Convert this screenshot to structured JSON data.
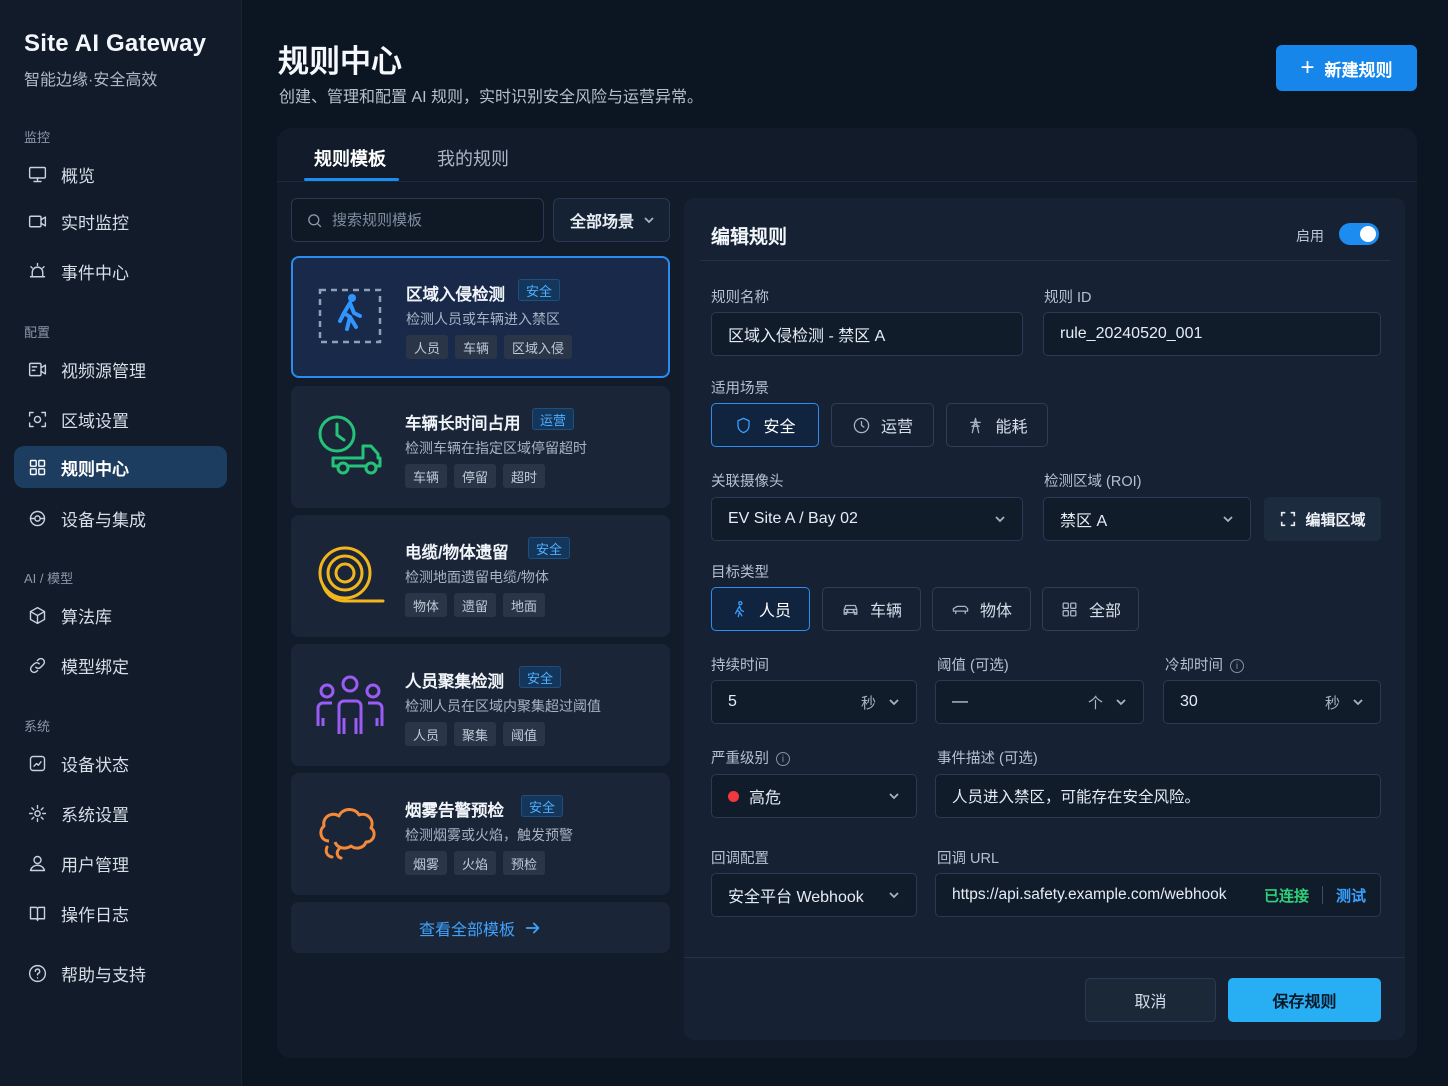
{
  "brand": {
    "title": "Site AI Gateway",
    "subtitle": "智能边缘·安全高效"
  },
  "sidebar": {
    "sections": [
      "监控",
      "配置",
      "AI / 模型",
      "系统"
    ],
    "items": [
      {
        "label": "概览",
        "icon": "monitor-icon"
      },
      {
        "label": "实时监控",
        "icon": "camera-icon"
      },
      {
        "label": "事件中心",
        "icon": "alarm-icon"
      },
      {
        "label": "视频源管理",
        "icon": "video-source-icon"
      },
      {
        "label": "区域设置",
        "icon": "region-icon"
      },
      {
        "label": "规则中心",
        "icon": "grid-icon",
        "active": true
      },
      {
        "label": "设备与集成",
        "icon": "integration-icon"
      },
      {
        "label": "算法库",
        "icon": "cube-icon"
      },
      {
        "label": "模型绑定",
        "icon": "link-icon"
      },
      {
        "label": "设备状态",
        "icon": "device-status-icon"
      },
      {
        "label": "系统设置",
        "icon": "gear-icon"
      },
      {
        "label": "用户管理",
        "icon": "user-icon"
      },
      {
        "label": "操作日志",
        "icon": "book-icon"
      },
      {
        "label": "帮助与支持",
        "icon": "help-icon"
      }
    ]
  },
  "header": {
    "title": "规则中心",
    "subtitle": "创建、管理和配置 AI 规则，实时识别安全风险与运营异常。",
    "new_button": "新建规则"
  },
  "tabs": [
    "规则模板",
    "我的规则"
  ],
  "templates": {
    "search_placeholder": "搜索规则模板",
    "scene_filter": "全部场景",
    "items": [
      {
        "name": "区域入侵检测",
        "tag": "安全",
        "desc": "检测人员或车辆进入禁区",
        "chips": [
          "人员",
          "车辆",
          "区域入侵"
        ]
      },
      {
        "name": "车辆长时间占用",
        "tag": "运营",
        "desc": "检测车辆在指定区域停留超时",
        "chips": [
          "车辆",
          "停留",
          "超时"
        ]
      },
      {
        "name": "电缆/物体遗留",
        "tag": "安全",
        "desc": "检测地面遗留电缆/物体",
        "chips": [
          "物体",
          "遗留",
          "地面"
        ]
      },
      {
        "name": "人员聚集检测",
        "tag": "安全",
        "desc": "检测人员在区域内聚集超过阈值",
        "chips": [
          "人员",
          "聚集",
          "阈值"
        ]
      },
      {
        "name": "烟雾告警预检",
        "tag": "安全",
        "desc": "检测烟雾或火焰，触发预警",
        "chips": [
          "烟雾",
          "火焰",
          "预检"
        ]
      }
    ],
    "view_all": "查看全部模板"
  },
  "editor": {
    "title": "编辑规则",
    "enable_label": "启用",
    "enabled": true,
    "rule_name_label": "规则名称",
    "rule_name": "区域入侵检测 - 禁区 A",
    "rule_id_label": "规则 ID",
    "rule_id": "rule_20240520_001",
    "scene_label": "适用场景",
    "scenes": [
      "安全",
      "运营",
      "能耗"
    ],
    "camera_label": "关联摄像头",
    "camera": "EV Site A / Bay 02",
    "roi_label": "检测区域 (ROI)",
    "roi": "禁区 A",
    "edit_roi_button": "编辑区域",
    "target_label": "目标类型",
    "targets": [
      "人员",
      "车辆",
      "物体",
      "全部"
    ],
    "duration_label": "持续时间",
    "duration": "5",
    "duration_unit": "秒",
    "threshold_label": "阈值 (可选)",
    "threshold": "—",
    "threshold_unit": "个",
    "cooldown_label": "冷却时间",
    "cooldown": "30",
    "cooldown_unit": "秒",
    "severity_label": "严重级别",
    "severity": "高危",
    "severity_color": "#f0393f",
    "event_desc_label": "事件描述 (可选)",
    "event_desc": "人员进入禁区，可能存在安全风险。",
    "callback_label": "回调配置",
    "callback": "安全平台 Webhook",
    "callback_url_label": "回调 URL",
    "callback_url": "https://api.safety.example.com/webhook",
    "callback_status": "已连接",
    "test_button": "测试",
    "cancel_button": "取消",
    "save_button": "保存规则"
  },
  "colors": {
    "accent": "#1686ea",
    "save": "#28aef2",
    "connected": "#2fd07a"
  }
}
